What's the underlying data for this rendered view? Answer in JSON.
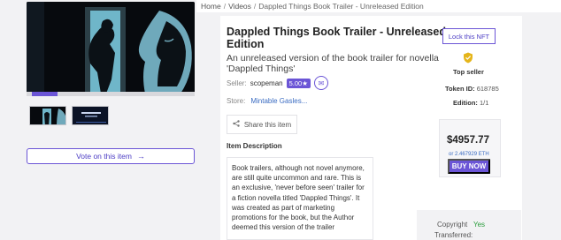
{
  "breadcrumb": {
    "home": "Home",
    "sep": "/",
    "videos": "Videos",
    "current": "Dappled Things Book Trailer - Unreleased Edition"
  },
  "item": {
    "title": "Dappled Things Book Trailer - Unreleased Edition",
    "subtitle": "An unreleased version of the book trailer for novella 'Dappled Things'",
    "seller_label": "Seller:",
    "seller_name": "scopeman",
    "seller_rating": "5.00★",
    "store_label": "Store:",
    "store_name": "Mintable Gasles...",
    "share_label": "Share this item",
    "description_label": "Item Description",
    "description": "Book trailers, although not novel anymore, are still quite uncommon and rare. This is an exclusive, 'never before seen' trailer for a fiction novella titled 'Dappled Things'. It was created as part of marketing promotions for the book, but the Author deemed this version of the trailer"
  },
  "media": {
    "vote_label": "Vote on this item",
    "progress": 0.16
  },
  "details": {
    "lock_label": "Lock this NFT",
    "top_seller": "Top seller",
    "token_label": "Token ID:",
    "token_id": "618785",
    "edition_label": "Edition:",
    "edition": "1/1",
    "price": "$4957.77",
    "eth": "or 2.467929 ETH",
    "buy_label": "BUY NOW",
    "copyright_label": "Copyright",
    "copyright_value": "Yes",
    "transferred_label": "Transferred:"
  },
  "colors": {
    "accent": "#6b55d6",
    "link": "#3b6cc2",
    "shield": "#e5b51a"
  }
}
